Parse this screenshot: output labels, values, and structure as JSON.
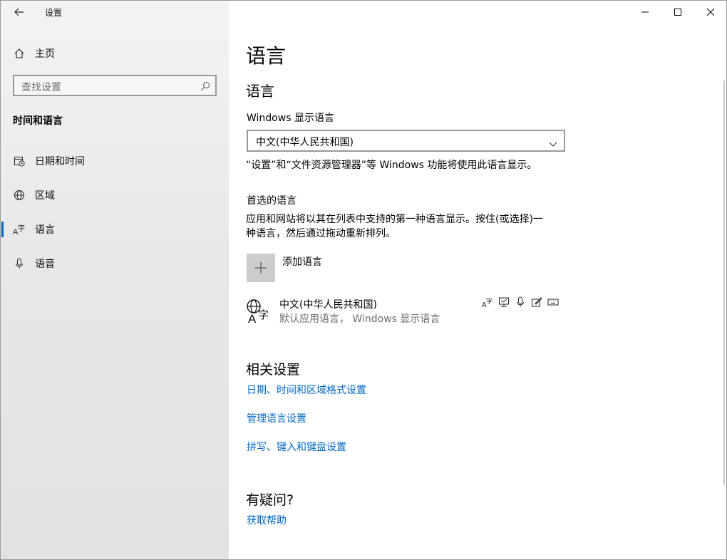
{
  "window": {
    "title": "设置"
  },
  "sidebar": {
    "home_label": "主页",
    "search_placeholder": "查找设置",
    "section_title": "时间和语言",
    "items": [
      {
        "label": "日期和时间",
        "icon": "calendar-clock-icon"
      },
      {
        "label": "区域",
        "icon": "globe-icon"
      },
      {
        "label": "语言",
        "icon": "language-icon",
        "selected": true
      },
      {
        "label": "语音",
        "icon": "microphone-icon"
      }
    ]
  },
  "main": {
    "page_title": "语言",
    "section_title": "语言",
    "display_language_label": "Windows 显示语言",
    "display_language_value": "中文(中华人民共和国)",
    "display_language_desc": "“设置”和“文件资源管理器”等 Windows 功能将使用此语言显示。",
    "preferred_title": "首选的语言",
    "preferred_desc_line1": "应用和网站将以其在列表中支持的第一种语言显示。按住(或选择)一",
    "preferred_desc_line2": "种语言，然后通过拖动重新排列。",
    "add_language_label": "添加语言",
    "language": {
      "name": "中文(中华人民共和国)",
      "detail": "默认应用语言， Windows 显示语言"
    },
    "related_title": "相关设置",
    "related_links": [
      "日期、时间和区域格式设置",
      "管理语言设置",
      "拼写、键入和键盘设置"
    ],
    "help_title": "有疑问?",
    "help_link": "获取帮助"
  },
  "colors": {
    "accent": "#0067c0",
    "sidebar_bg": "#ececec",
    "add_button_bg": "#cccccc"
  }
}
